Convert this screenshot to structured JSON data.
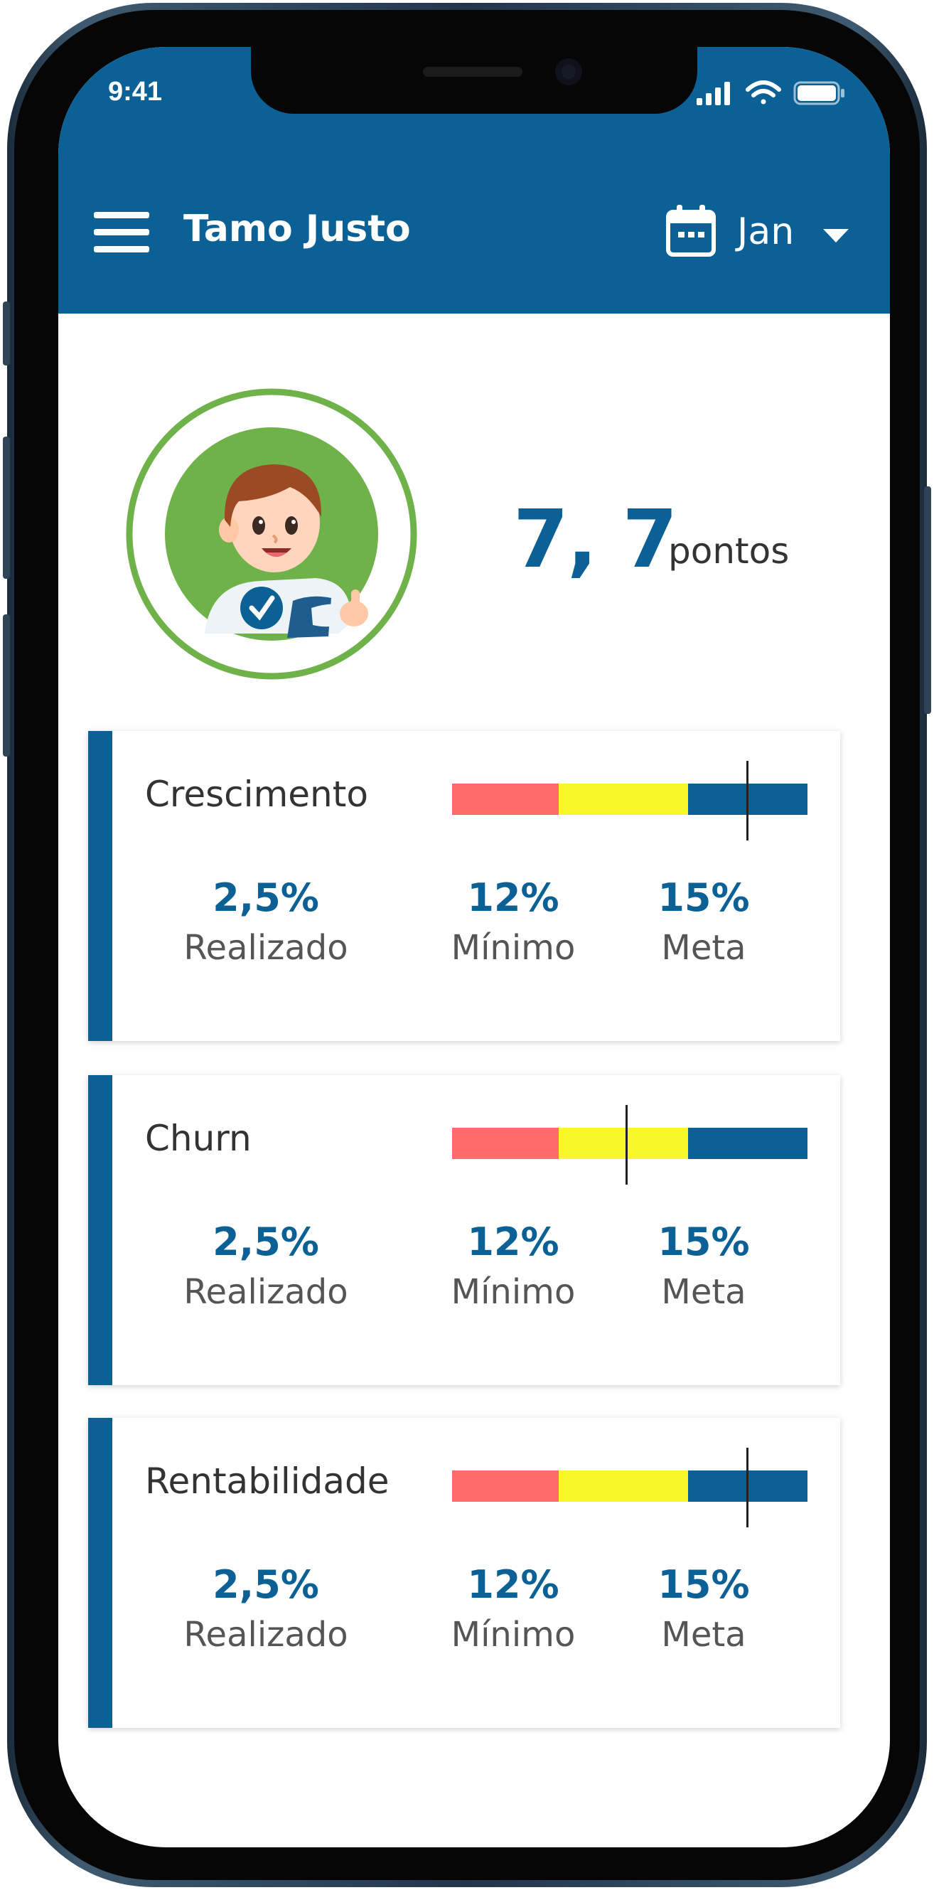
{
  "status_bar": {
    "time": "9:41"
  },
  "header": {
    "title": "Tamo Justo",
    "month": "Jan",
    "accent_color": "#0b6196"
  },
  "score": {
    "value": "7, 7",
    "unit": "pontos"
  },
  "avatar": {
    "ring_color": "#6fb24a",
    "description_icon": "mascot-avatar"
  },
  "range_colors": {
    "below": "#ff6b6b",
    "minimum": "#f7f72a",
    "goal": "#0b6196"
  },
  "metrics": [
    {
      "title": "Crescimento",
      "marker_position": 0.83,
      "stats": [
        {
          "value": "2,5%",
          "label": "Realizado"
        },
        {
          "value": "12%",
          "label": "Mínimo"
        },
        {
          "value": "15%",
          "label": "Meta"
        }
      ]
    },
    {
      "title": "Churn",
      "marker_position": 0.49,
      "stats": [
        {
          "value": "2,5%",
          "label": "Realizado"
        },
        {
          "value": "12%",
          "label": "Mínimo"
        },
        {
          "value": "15%",
          "label": "Meta"
        }
      ]
    },
    {
      "title": "Rentabilidade",
      "marker_position": 0.83,
      "stats": [
        {
          "value": "2,5%",
          "label": "Realizado"
        },
        {
          "value": "12%",
          "label": "Mínimo"
        },
        {
          "value": "15%",
          "label": "Meta"
        }
      ]
    }
  ]
}
